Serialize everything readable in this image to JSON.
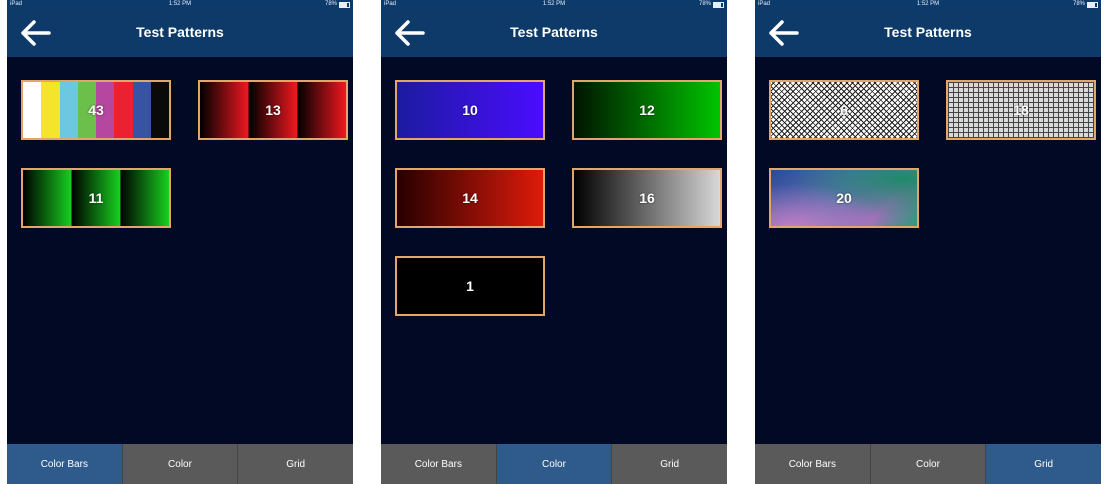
{
  "status_bar": {
    "carrier": "iPad",
    "wifi_icon": "wifi-icon",
    "time": "1:52 PM",
    "battery_percent": "78%"
  },
  "nav": {
    "title": "Test Patterns",
    "back_icon": "back-arrow-icon"
  },
  "tabs": [
    "Color Bars",
    "Color",
    "Grid"
  ],
  "accent_colors": {
    "nav": "#0d3a68",
    "active_tab": "#2e5b8c",
    "inactive_tab": "#5a5a5a",
    "tile_border": "#e3a66a",
    "background": "#020924"
  },
  "screens": [
    {
      "active_tab": "Color Bars",
      "patterns": [
        {
          "number": "43",
          "pattern": "color-bars"
        },
        {
          "number": "13",
          "pattern": "red-ramp-bars"
        },
        {
          "number": "11",
          "pattern": "green-ramp-bars"
        }
      ]
    },
    {
      "active_tab": "Color",
      "patterns": [
        {
          "number": "10",
          "pattern": "blue-gradient"
        },
        {
          "number": "12",
          "pattern": "green-gradient"
        },
        {
          "number": "14",
          "pattern": "red-gradient"
        },
        {
          "number": "16",
          "pattern": "gray-gradient"
        },
        {
          "number": "1",
          "pattern": "black"
        }
      ]
    },
    {
      "active_tab": "Grid",
      "patterns": [
        {
          "number": "6",
          "pattern": "checkerboard"
        },
        {
          "number": "18",
          "pattern": "grid"
        },
        {
          "number": "20",
          "pattern": "pastel-gradient"
        }
      ]
    }
  ]
}
